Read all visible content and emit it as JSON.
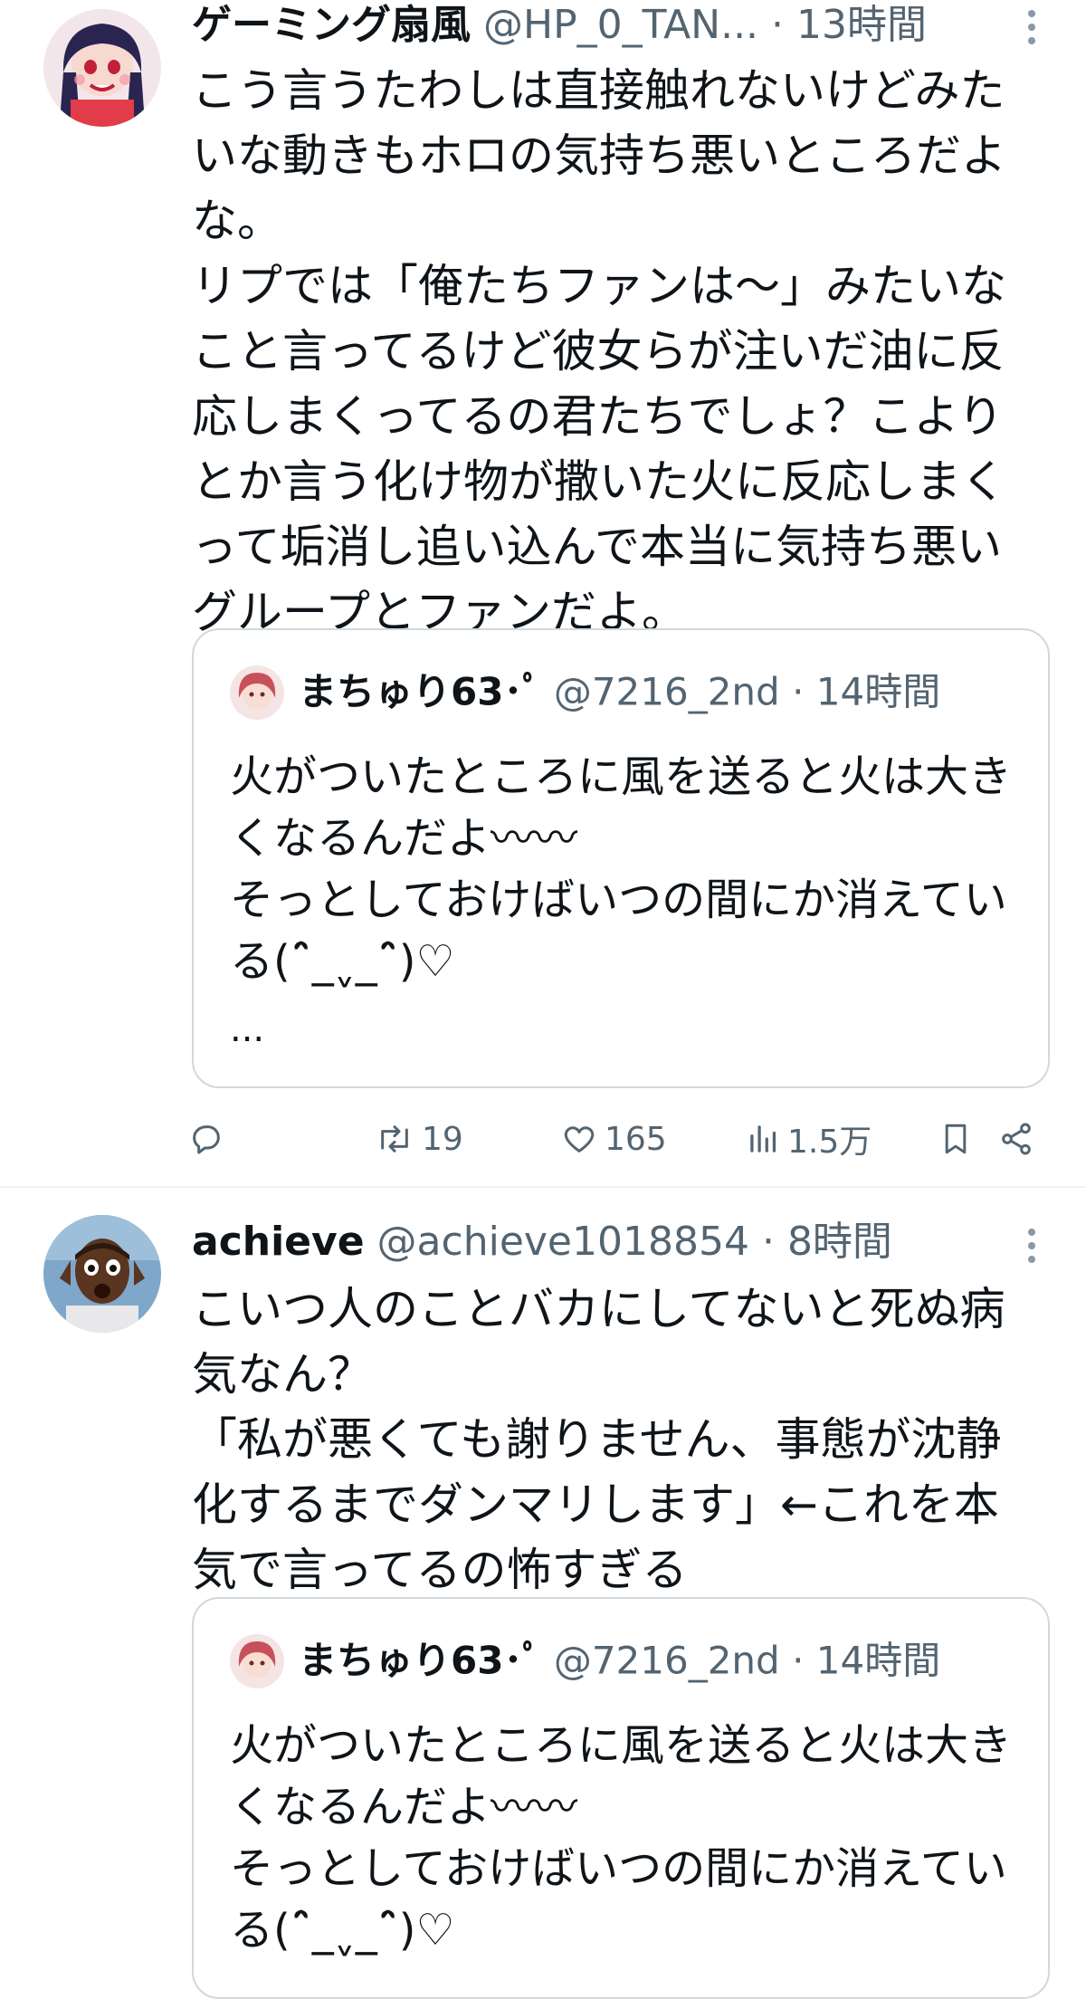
{
  "tweets": [
    {
      "display_name": "ゲーミング扇風",
      "handle": "@HP_0_TAN...",
      "time": "13時間",
      "body": "こう言うたわしは直接触れないけどみたいな動きもホロの気持ち悪いところだよな。\nリプでは「俺たちファンは〜」みたいなこと言ってるけど彼女らが注いだ油に反応しまくってるの君たちでしょ？こよりとか言う化け物が撒いた火に反応しまくって垢消し追い込んで本当に気持ち悪いグループとファンだよ。",
      "quote": {
        "display_name": "まちゅり63･ﾟ",
        "handle": "@7216_2nd",
        "time": "14時間",
        "body": "火がついたところに風を送ると火は大きくなるんだよ〰〰\nそっとしておけばいつの間にか消えている(ˆ̑_ˬ_ˆ̑)♡",
        "ellipsis": "..."
      },
      "actions": {
        "reply": "",
        "retweet": "19",
        "like": "165",
        "views": "1.5万"
      }
    },
    {
      "display_name": "achieve",
      "handle": "@achieve1018854",
      "time": "8時間",
      "body": "こいつ人のことバカにしてないと死ぬ病気なん？\n「私が悪くても謝りません、事態が沈静化するまでダンマリします」←これを本気で言ってるの怖すぎる",
      "quote": {
        "display_name": "まちゅり63･ﾟ",
        "handle": "@7216_2nd",
        "time": "14時間",
        "body": "火がついたところに風を送ると火は大きくなるんだよ〰〰\nそっとしておけばいつの間にか消えている(ˆ̑_ˬ_ˆ̑)♡"
      }
    }
  ],
  "colors": {
    "text": "#0f1419",
    "meta": "#536471",
    "border": "#cfd9de",
    "divider": "#eff3f4"
  },
  "icons": [
    "reply-icon",
    "retweet-icon",
    "like-icon",
    "views-icon",
    "bookmark-icon",
    "share-icon",
    "more-icon"
  ]
}
